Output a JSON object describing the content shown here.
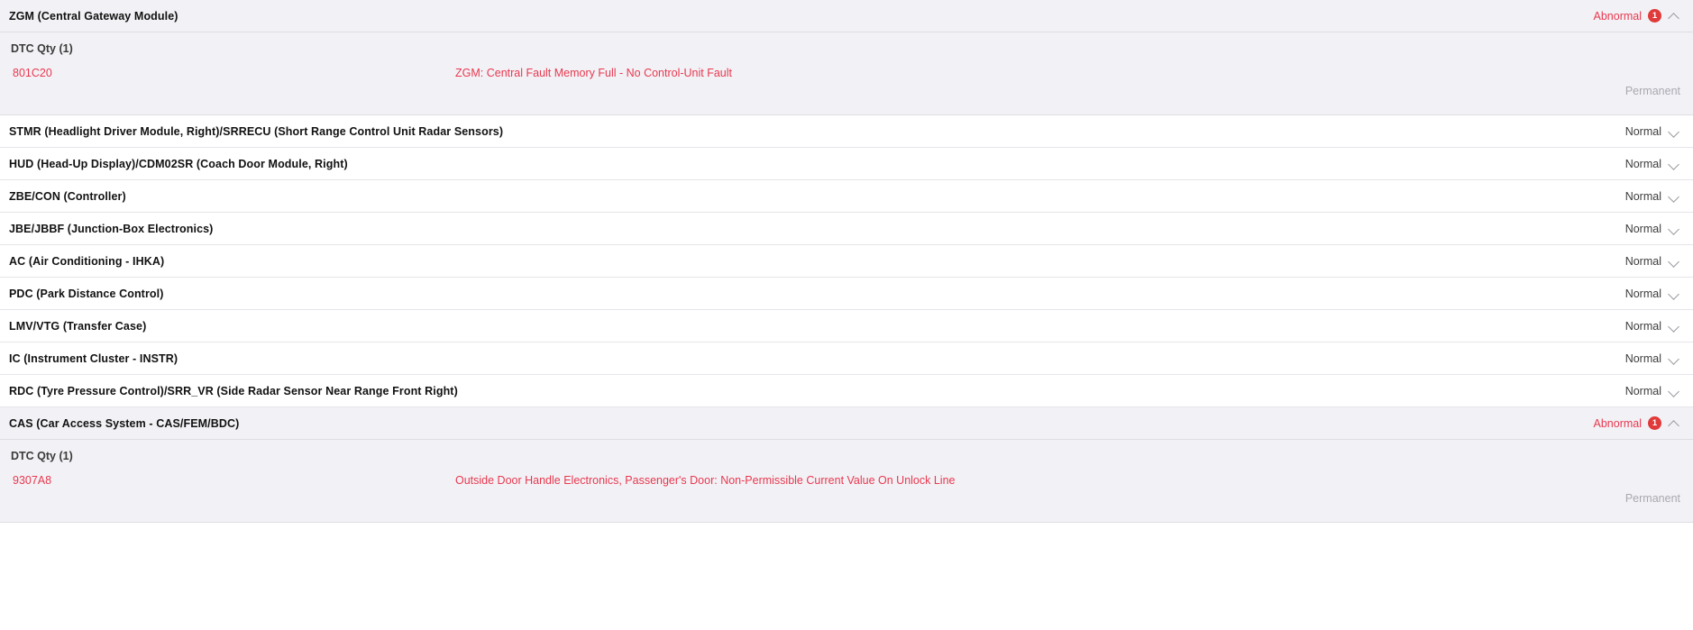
{
  "labels": {
    "dtc_qty_prefix": "DTC Qty",
    "status_normal": "Normal",
    "status_abnormal": "Abnormal",
    "state_permanent": "Permanent"
  },
  "colors": {
    "abnormal": "#e8384f",
    "badge": "#e03a3a",
    "normal_text": "#3c3c3c",
    "expanded_bg": "#f2f2f6",
    "state_text": "#a8a8b0"
  },
  "modules": [
    {
      "id": "zgm",
      "name": "ZGM (Central Gateway Module)",
      "status": "Abnormal",
      "abnormal": true,
      "count": "1",
      "expanded": true,
      "chevron": "chevron-up-icon",
      "dtc_qty_label": "DTC Qty (1)",
      "dtcs": [
        {
          "code": "801C20",
          "description": "ZGM: Central Fault Memory Full - No Control-Unit Fault",
          "state": "Permanent"
        }
      ]
    },
    {
      "id": "stmr",
      "name": "STMR (Headlight Driver Module, Right)/SRRECU (Short Range Control Unit Radar Sensors)",
      "status": "Normal",
      "abnormal": false,
      "count": "",
      "expanded": false,
      "chevron": "chevron-down-icon",
      "dtc_qty_label": "",
      "dtcs": []
    },
    {
      "id": "hud",
      "name": "HUD (Head-Up Display)/CDM02SR (Coach Door Module, Right)",
      "status": "Normal",
      "abnormal": false,
      "count": "",
      "expanded": false,
      "chevron": "chevron-down-icon",
      "dtc_qty_label": "",
      "dtcs": []
    },
    {
      "id": "zbe-con",
      "name": "ZBE/CON (Controller)",
      "status": "Normal",
      "abnormal": false,
      "count": "",
      "expanded": false,
      "chevron": "chevron-down-icon",
      "dtc_qty_label": "",
      "dtcs": []
    },
    {
      "id": "jbe-jbbf",
      "name": "JBE/JBBF (Junction-Box Electronics)",
      "status": "Normal",
      "abnormal": false,
      "count": "",
      "expanded": false,
      "chevron": "chevron-down-icon",
      "dtc_qty_label": "",
      "dtcs": []
    },
    {
      "id": "ac",
      "name": "AC (Air Conditioning - IHKA)",
      "status": "Normal",
      "abnormal": false,
      "count": "",
      "expanded": false,
      "chevron": "chevron-down-icon",
      "dtc_qty_label": "",
      "dtcs": []
    },
    {
      "id": "pdc",
      "name": "PDC (Park Distance Control)",
      "status": "Normal",
      "abnormal": false,
      "count": "",
      "expanded": false,
      "chevron": "chevron-down-icon",
      "dtc_qty_label": "",
      "dtcs": []
    },
    {
      "id": "lmv-vtg",
      "name": "LMV/VTG (Transfer Case)",
      "status": "Normal",
      "abnormal": false,
      "count": "",
      "expanded": false,
      "chevron": "chevron-down-icon",
      "dtc_qty_label": "",
      "dtcs": []
    },
    {
      "id": "ic",
      "name": "IC (Instrument Cluster - INSTR)",
      "status": "Normal",
      "abnormal": false,
      "count": "",
      "expanded": false,
      "chevron": "chevron-down-icon",
      "dtc_qty_label": "",
      "dtcs": []
    },
    {
      "id": "rdc",
      "name": "RDC (Tyre Pressure Control)/SRR_VR (Side Radar Sensor Near Range Front Right)",
      "status": "Normal",
      "abnormal": false,
      "count": "",
      "expanded": false,
      "chevron": "chevron-down-icon",
      "dtc_qty_label": "",
      "dtcs": []
    },
    {
      "id": "cas",
      "name": "CAS (Car Access System - CAS/FEM/BDC)",
      "status": "Abnormal",
      "abnormal": true,
      "count": "1",
      "expanded": true,
      "chevron": "chevron-up-icon",
      "dtc_qty_label": "DTC Qty (1)",
      "dtcs": [
        {
          "code": "9307A8",
          "description": "Outside Door Handle Electronics, Passenger's Door: Non-Permissible Current Value On Unlock Line",
          "state": "Permanent"
        }
      ]
    }
  ]
}
